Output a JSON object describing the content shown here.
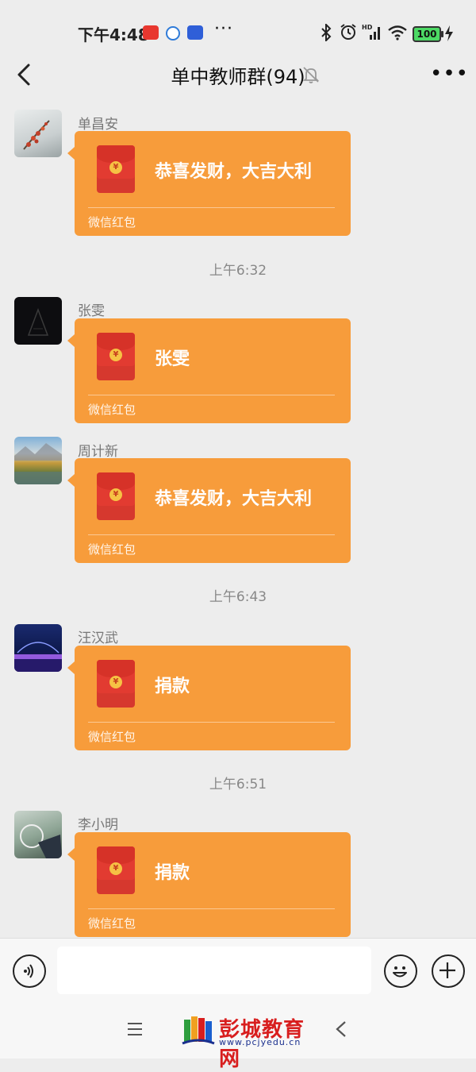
{
  "status_bar": {
    "time": "下午4:48",
    "battery": "100",
    "app_icons": [
      "toutiao-icon",
      "browser-icon",
      "baidu-icon"
    ],
    "right_icons": [
      "bluetooth-icon",
      "alarm-icon",
      "hd-signal-icon",
      "wifi-icon",
      "battery-icon",
      "charging-icon"
    ]
  },
  "header": {
    "title": "单中教师群(94)",
    "muted": true
  },
  "chat": {
    "messages": [
      {
        "sender": "单昌安",
        "text": "恭喜发财，大吉大利",
        "label": "微信红包"
      },
      {
        "sender": "张雯",
        "text": "张雯",
        "label": "微信红包"
      },
      {
        "sender": "周计新",
        "text": "恭喜发财，大吉大利",
        "label": "微信红包"
      },
      {
        "sender": "汪汉武",
        "text": "捐款",
        "label": "微信红包"
      },
      {
        "sender": "李小明",
        "text": "捐款",
        "label": "微信红包"
      }
    ],
    "timestamps": [
      "上午6:32",
      "上午6:43",
      "上午6:51"
    ]
  },
  "input_bar": {
    "placeholder": "",
    "value": ""
  },
  "watermark": {
    "title": "彭城教育网",
    "url": "www.pcjyedu.cn"
  },
  "colors": {
    "background": "#ededed",
    "red_packet": "#f79c3b",
    "envelope": "#e23b31"
  }
}
